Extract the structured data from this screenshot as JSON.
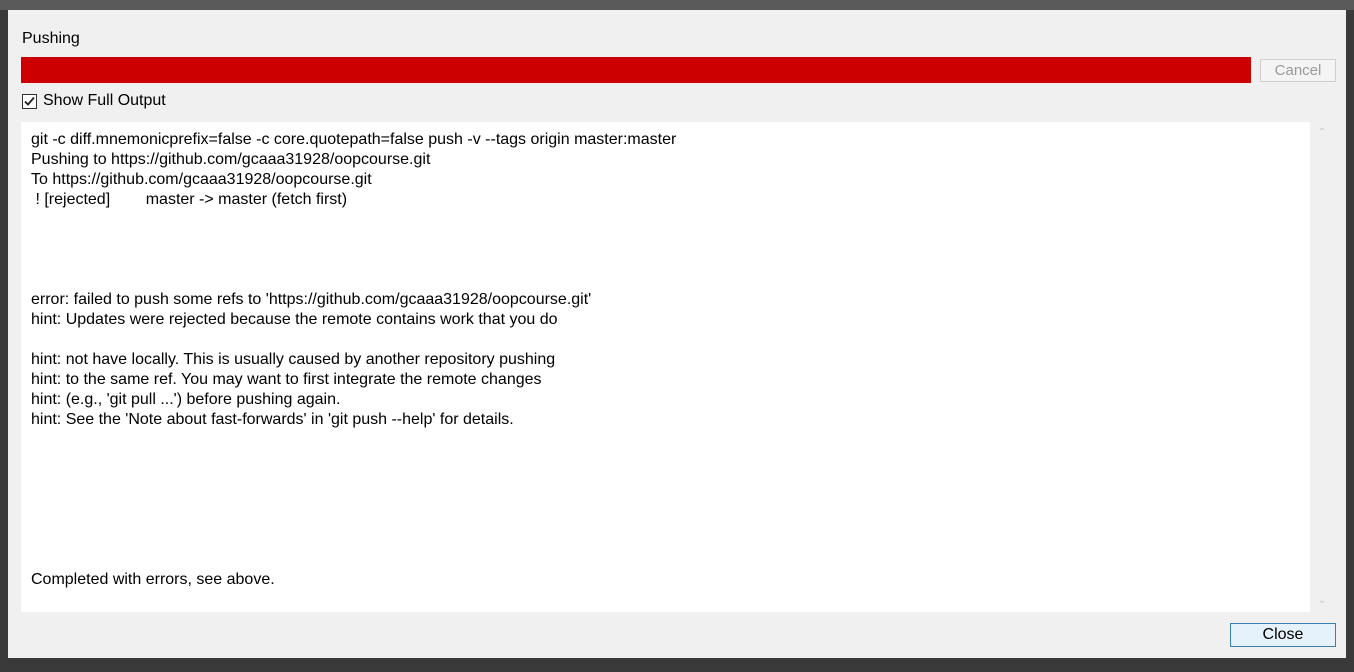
{
  "dialog": {
    "title": "Pushing",
    "progress": 1.0,
    "progress_color": "#cc0000",
    "cancel_label": "Cancel",
    "show_full_output": {
      "label": "Show Full Output",
      "checked": true
    },
    "output_lines": [
      "git -c diff.mnemonicprefix=false -c core.quotepath=false push -v --tags origin master:master",
      "Pushing to https://github.com/gcaaa31928/oopcourse.git",
      "To https://github.com/gcaaa31928/oopcourse.git",
      " ! [rejected]        master -> master (fetch first)",
      "",
      "",
      "",
      "",
      "error: failed to push some refs to 'https://github.com/gcaaa31928/oopcourse.git'",
      "hint: Updates were rejected because the remote contains work that you do",
      "",
      "hint: not have locally. This is usually caused by another repository pushing",
      "hint: to the same ref. You may want to first integrate the remote changes",
      "hint: (e.g., 'git pull ...') before pushing again.",
      "hint: See the 'Note about fast-forwards' in 'git push --help' for details.",
      "",
      "",
      "",
      "",
      "",
      "",
      "",
      "Completed with errors, see above."
    ],
    "close_label": "Close"
  }
}
